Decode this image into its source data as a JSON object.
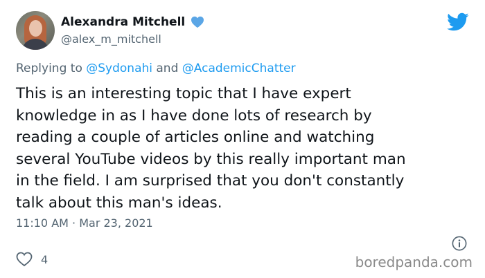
{
  "author": {
    "display_name": "Alexandra Mitchell",
    "handle": "@alex_m_mitchell",
    "verified_icon": "blue-heart-icon"
  },
  "reply": {
    "prefix": "Replying to ",
    "mention_1": "@Sydonahi",
    "joiner": " and ",
    "mention_2": "@AcademicChatter"
  },
  "tweet": {
    "text": "This is an interesting topic that I have expert\nknowledge in as I have done lots of research by\nreading a couple of articles online and watching\nseveral YouTube videos by this really important man\nin the field. I am surprised that you don't constantly\ntalk about this man's ideas.",
    "timestamp": "11:10 AM · Mar 23, 2021",
    "like_count": "4"
  },
  "watermark": "boredpanda.com",
  "colors": {
    "twitter_blue": "#1d9bf0",
    "heart_blue": "#5ba6e6",
    "secondary_text": "#536471",
    "primary_text": "#0f1419"
  }
}
